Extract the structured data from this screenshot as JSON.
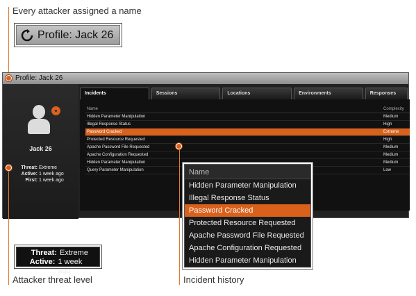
{
  "callouts": {
    "name_label": "Every attacker assigned a name",
    "threat_label": "Attacker threat level",
    "incident_label": "Incident history"
  },
  "zoom_profile": {
    "label": "Profile: Jack 26"
  },
  "zoom_threat": [
    {
      "key": "Threat:",
      "value": "Extreme"
    },
    {
      "key": "Active:",
      "value": "1 week ago"
    }
  ],
  "window": {
    "title": "Profile: Jack 26"
  },
  "profile": {
    "name": "Jack 26",
    "stats": [
      {
        "key": "Threat:",
        "value": "Extreme"
      },
      {
        "key": "Active:",
        "value": "1 week ago"
      },
      {
        "key": "First:",
        "value": "1 week ago"
      }
    ]
  },
  "tabs": [
    "Incidents",
    "Sessions",
    "Locations",
    "Environments",
    "Responses"
  ],
  "incidents_table": {
    "columns": [
      "Name",
      "Complexity"
    ],
    "rows": [
      {
        "name": "Hidden Parameter Manipulation",
        "complexity": "Medium"
      },
      {
        "name": "Illegal Response Status",
        "complexity": "High"
      },
      {
        "name": "Password Cracked",
        "complexity": "Extreme"
      },
      {
        "name": "Protected Resource Requested",
        "complexity": "High"
      },
      {
        "name": "Apache Password File Requested",
        "complexity": "Medium"
      },
      {
        "name": "Apache Configuration Requested",
        "complexity": "Medium"
      },
      {
        "name": "Hidden Parameter Manipulation",
        "complexity": "Medium"
      },
      {
        "name": "Query Parameter Manipulation",
        "complexity": "Low"
      }
    ],
    "selected_index": 2
  },
  "zoom_incidents": {
    "header": "Name",
    "rows": [
      "Hidden Parameter Manipulation",
      "Illegal Response Status",
      "Password Cracked",
      "Protected Resource Requested",
      "Apache Password File Requested",
      "Apache Configuration Requested",
      "Hidden Parameter Manipulation"
    ],
    "selected_index": 2
  },
  "colors": {
    "accent": "#d9611c"
  }
}
